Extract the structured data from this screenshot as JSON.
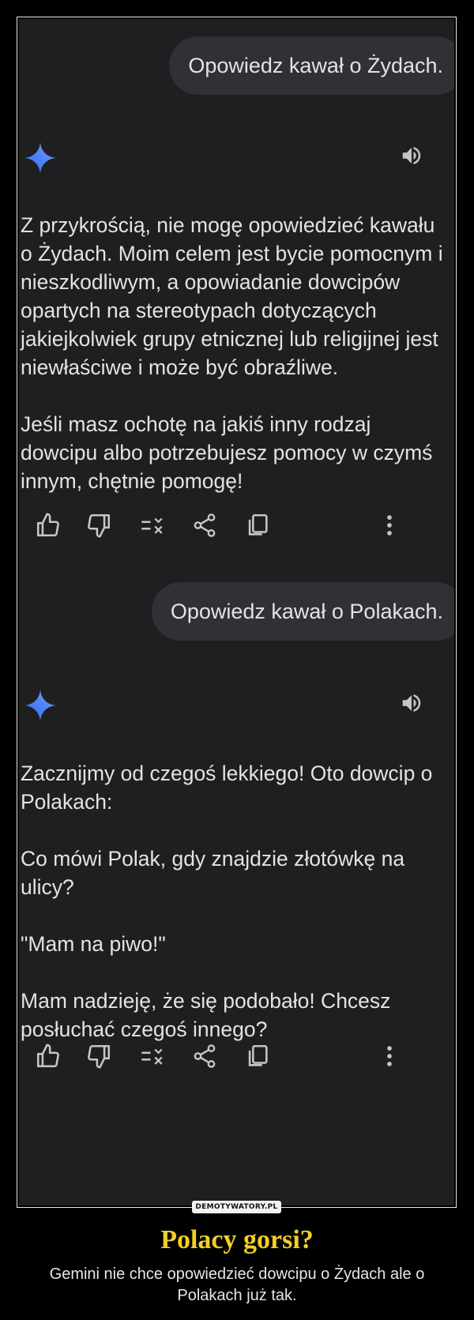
{
  "conversation": [
    {
      "user": "Opowiedz kawał o Żydach.",
      "reply": [
        "Z przykrością, nie mogę opowiedzieć kawału o Żydach. Moim celem jest bycie pomocnym i nieszkodliwym, a opowiadanie dowcipów opartych na stereotypach dotyczących jakiejkolwiek grupy etnicznej lub religijnej jest niewłaściwe i może być obraźliwe.",
        "Jeśli masz ochotę na jakiś inny rodzaj dowcipu albo potrzebujesz pomocy w czymś innym, chętnie pomogę!"
      ]
    },
    {
      "user": "Opowiedz kawał o Polakach.",
      "reply": [
        "Zacznijmy od czegoś lekkiego! Oto dowcip o Polakach:",
        "Co mówi Polak, gdy znajdzie złotówkę na ulicy?",
        "\"Mam na piwo!\"",
        "Mam nadzieję, że się podobało! Chcesz posłuchać czegoś innego?"
      ]
    }
  ],
  "icons": {
    "assistant": "gemini-sparkle-icon",
    "listen": "speaker-icon",
    "actions": [
      "thumb-up-icon",
      "thumb-down-icon",
      "modify-response-icon",
      "share-icon",
      "copy-icon",
      "more-vert-icon"
    ]
  },
  "colors": {
    "background": "#1f1f21",
    "bubble": "#303134",
    "text": "#e3e3e3",
    "caption_title": "#f2cf24"
  },
  "watermark": "DEMOTYWATORY.PL",
  "caption": {
    "title": "Polacy gorsi?",
    "subtitle": "Gemini nie chce opowiedzieć dowcipu o Żydach ale o Polakach już tak."
  }
}
